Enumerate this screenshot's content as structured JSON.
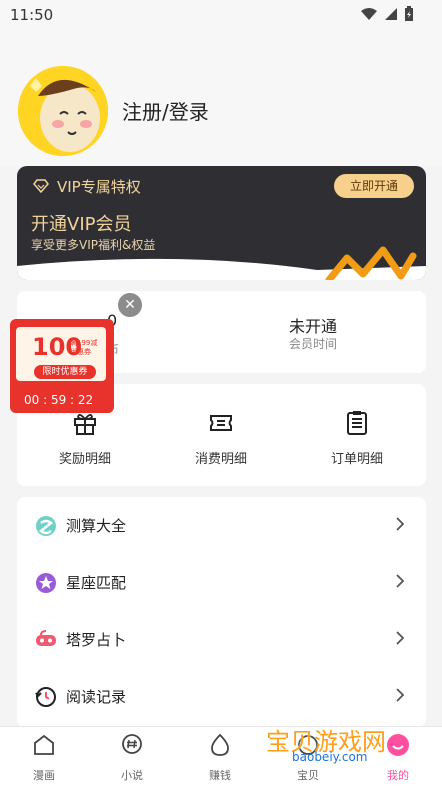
{
  "status": {
    "time": "11:50"
  },
  "profile": {
    "login_label": "注册/登录"
  },
  "vip": {
    "title": "VIP专属特权",
    "button": "立即开通",
    "headline": "开通VIP会员",
    "subtitle": "享受更多VIP福利&权益"
  },
  "stats": [
    {
      "value": "0",
      "label": "币"
    },
    {
      "value": "未开通",
      "label": "会员时间"
    }
  ],
  "details": [
    {
      "label": "奖励明细"
    },
    {
      "label": "消费明细"
    },
    {
      "label": "订单明细"
    }
  ],
  "menu": [
    {
      "label": "测算大全"
    },
    {
      "label": "星座匹配"
    },
    {
      "label": "塔罗占卜"
    },
    {
      "label": "阅读记录"
    }
  ],
  "tabs": [
    {
      "label": "漫画"
    },
    {
      "label": "小说"
    },
    {
      "label": "赚钱"
    },
    {
      "label": "宝贝"
    },
    {
      "label": "我的"
    }
  ],
  "coupon": {
    "amount": "100",
    "mini_text": "满199减\n优惠券",
    "limited": "限时优惠券",
    "timer": "00 : 59 : 22"
  },
  "watermark": {
    "main": "宝贝游戏网",
    "sub": "baobeiy.com"
  },
  "colors": {
    "accent": "#ff4fa0",
    "vip_gold": "#f1d39a",
    "vip_bg": "#2f2f33"
  }
}
